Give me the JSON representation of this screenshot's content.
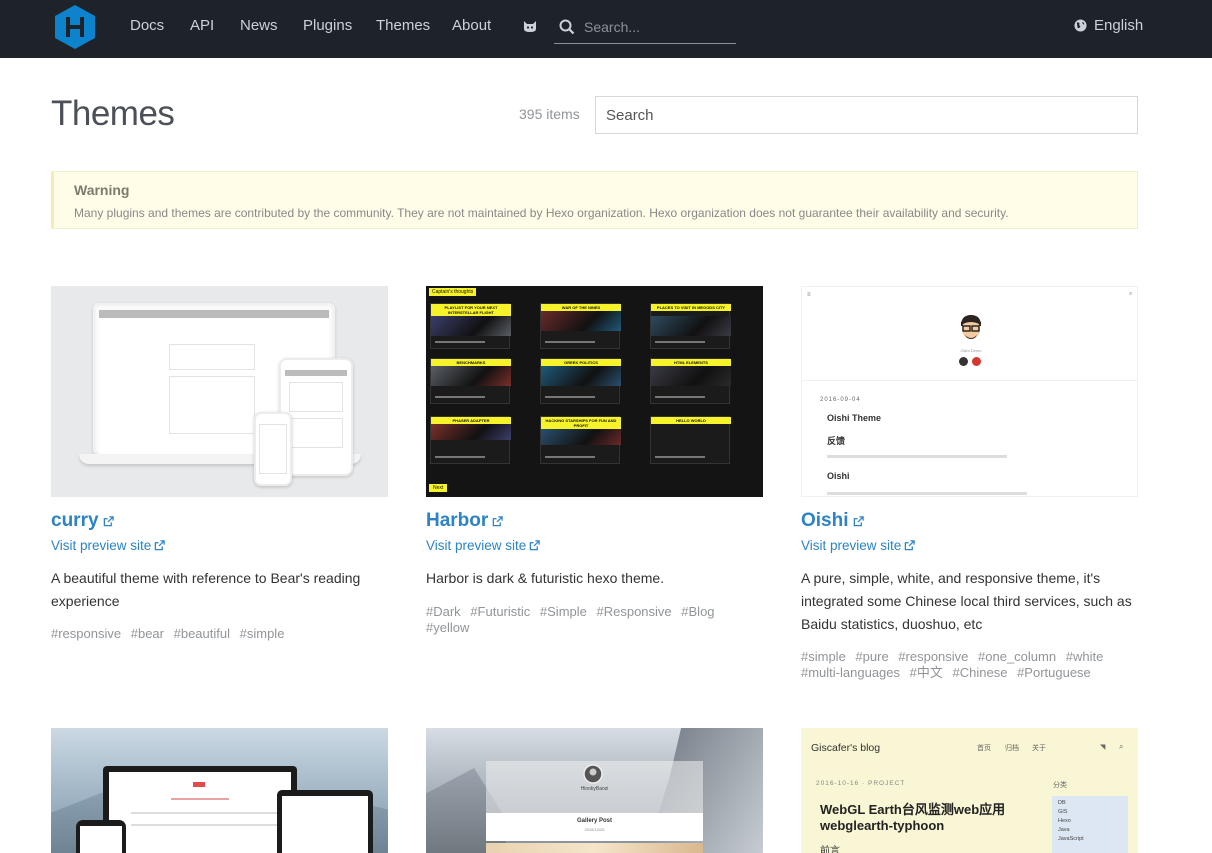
{
  "nav": {
    "items": [
      "Docs",
      "API",
      "News",
      "Plugins",
      "Themes",
      "About"
    ],
    "search_placeholder": "Search...",
    "language": "English"
  },
  "page": {
    "title": "Themes",
    "count": "395 items",
    "search_placeholder": "Search"
  },
  "warning": {
    "title": "Warning",
    "text": "Many plugins and themes are contributed by the community. They are not maintained by Hexo organization. Hexo organization does not guarantee their availability and security."
  },
  "cards": [
    {
      "name": "curry",
      "preview": "Visit preview site",
      "description": "A beautiful theme with reference to Bear's reading experience",
      "tags": [
        "#responsive",
        "#bear",
        "#beautiful",
        "#simple"
      ]
    },
    {
      "name": "Harbor",
      "preview": "Visit preview site",
      "description": "Harbor is dark & futuristic hexo theme.",
      "tags": [
        "#Dark",
        "#Futuristic",
        "#Simple",
        "#Responsive",
        "#Blog",
        "#yellow"
      ]
    },
    {
      "name": "Oishi",
      "preview": "Visit preview site",
      "description": "A pure, simple, white, and responsive theme, it's integrated some Chinese local third services, such as Baidu statistics, duoshuo, etc",
      "tags": [
        "#simple",
        "#pure",
        "#responsive",
        "#one_column",
        "#white",
        "#multi-languages",
        "#中文",
        "#Chinese",
        "#Portuguese"
      ]
    }
  ],
  "thumbs": {
    "harbor": {
      "label": "Captain's thoughts",
      "tiles": [
        "PLAYLIST FOR YOUR NEXT INTERSTELLAR FLIGHT",
        "WAR OF THE NINES",
        "PLACES TO VISIT IN MEGODS CITY",
        "BENCHMARKS",
        "GREEK POLITICS",
        "HTML ELEMENTS",
        "PHASER ADAPTER",
        "HACKING STARSHIPS FOR FUN AND PROFIT",
        "HELLO WORLD"
      ],
      "next": "Next"
    },
    "oishi": {
      "author": "Oishi Demo",
      "date": "2016-09-04",
      "post_title": "Oishi Theme",
      "section": "反馈",
      "subtitle": "Oishi"
    },
    "giscafer": {
      "blog": "Giscafer's blog",
      "menu": [
        "首页",
        "归档",
        "关于"
      ],
      "meta": "2016-10-16 · PROJECT",
      "post_title": "WebGL Earth台风监测web应用 webglearth-typhoon",
      "excerpt": "前言",
      "category_title": "分类",
      "categories": [
        "DB",
        "GIS",
        "Hexo",
        "Java",
        "JavaScript"
      ]
    },
    "gallery": {
      "user": "HinokyBaozi",
      "post": "Gallery Post",
      "date": "2015/12/25"
    }
  },
  "colors": {
    "header_bg": "#1d2329",
    "link": "#2c83c5",
    "logo": "#0e83cd",
    "warning_bg": "#fffde8"
  }
}
